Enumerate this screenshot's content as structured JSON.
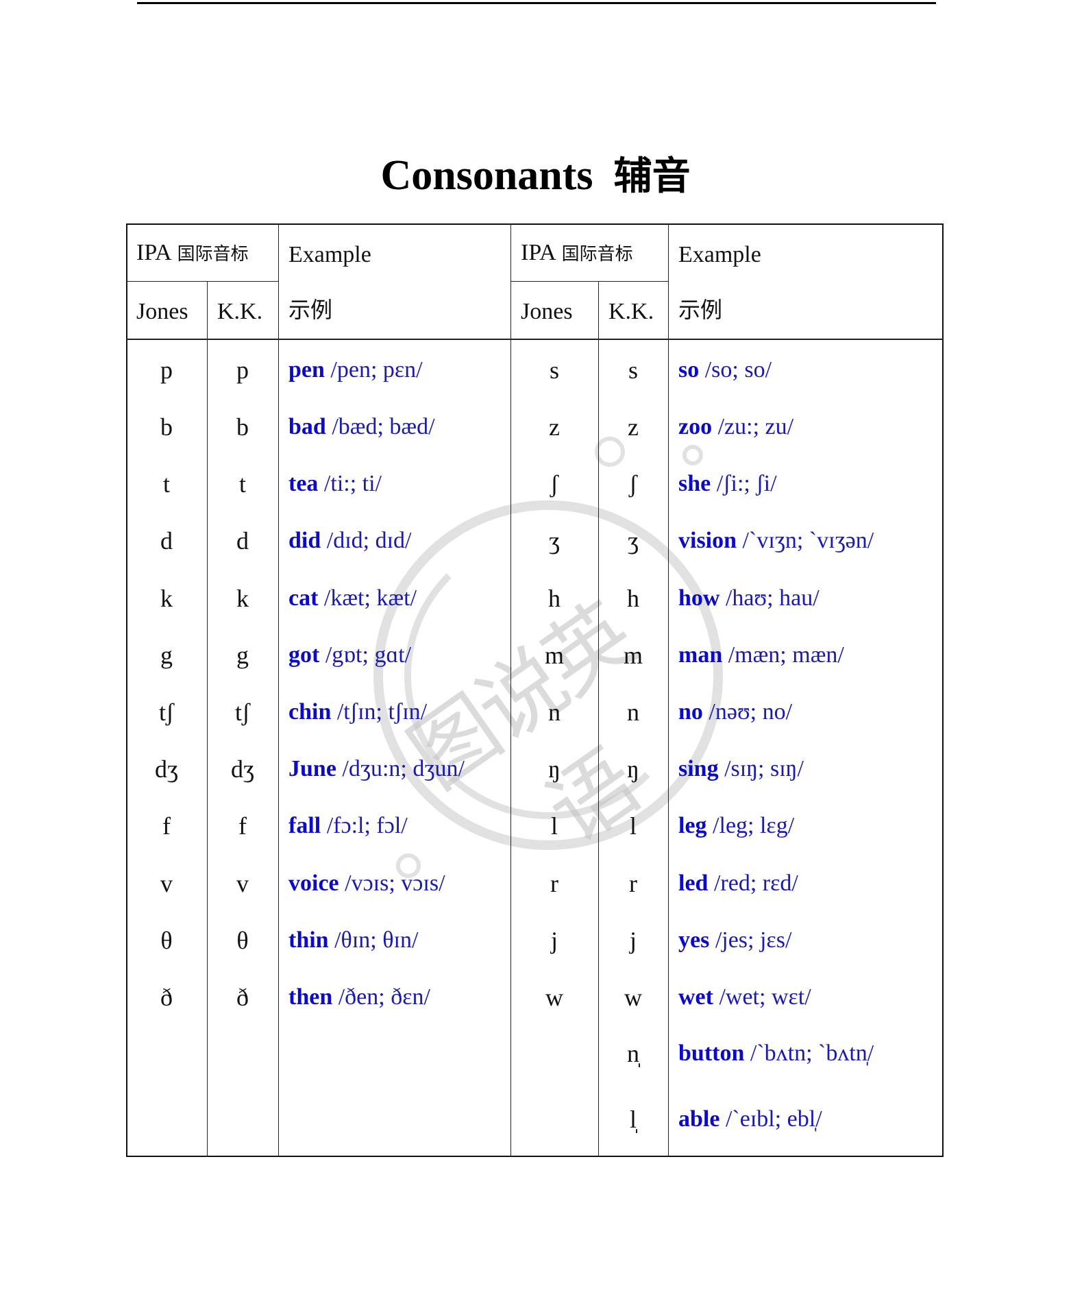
{
  "title": {
    "en": "Consonants",
    "zh": "辅音"
  },
  "watermark": {
    "text": "图说英语"
  },
  "header": {
    "ipa_label": "IPA",
    "ipa_zh": "国际音标",
    "jones": "Jones",
    "kk": "K.K.",
    "example_en": "Example",
    "example_zh": "示例"
  },
  "colors": {
    "example_word": "#0a0ac8",
    "transcription": "#1a1ab0",
    "text": "#111111",
    "border": "#111111"
  },
  "left_rows": [
    {
      "jones": "p",
      "kk": "p",
      "word": "pen",
      "transcription": "/pen; pɛn/"
    },
    {
      "jones": "b",
      "kk": "b",
      "word": "bad",
      "transcription": "/bæd; bæd/"
    },
    {
      "jones": "t",
      "kk": "t",
      "word": "tea",
      "transcription": "/ti:; ti/"
    },
    {
      "jones": "d",
      "kk": "d",
      "word": "did",
      "transcription": "/dɪd; dɪd/"
    },
    {
      "jones": "k",
      "kk": "k",
      "word": "cat",
      "transcription": "/kæt; kæt/"
    },
    {
      "jones": "g",
      "kk": "g",
      "word": "got",
      "transcription": "/gɒt; gɑt/"
    },
    {
      "jones": "tʃ",
      "kk": "tʃ",
      "word": "chin",
      "transcription": "/tʃɪn; tʃɪn/"
    },
    {
      "jones": "dʒ",
      "kk": "dʒ",
      "word": "June",
      "transcription": "/dʒu:n; dʒun/"
    },
    {
      "jones": "f",
      "kk": "f",
      "word": "fall",
      "transcription": "/fɔ:l; fɔl/"
    },
    {
      "jones": "v",
      "kk": "v",
      "word": "voice",
      "transcription": "/vɔɪs; vɔɪs/"
    },
    {
      "jones": "θ",
      "kk": "θ",
      "word": "thin",
      "transcription": "/θɪn; θɪn/"
    },
    {
      "jones": "ð",
      "kk": "ð",
      "word": "then",
      "transcription": "/ðen; ðɛn/"
    }
  ],
  "right_rows": [
    {
      "jones": "s",
      "kk": "s",
      "word": "so",
      "transcription": "/so; so/"
    },
    {
      "jones": "z",
      "kk": "z",
      "word": "zoo",
      "transcription": "/zu:; zu/"
    },
    {
      "jones": "ʃ",
      "kk": "ʃ",
      "word": "she",
      "transcription": "/ʃi:; ʃi/"
    },
    {
      "jones": "ʒ",
      "kk": "ʒ",
      "word": "vision",
      "transcription": "/`vɪʒn; `vɪʒən/"
    },
    {
      "jones": "h",
      "kk": "h",
      "word": "how",
      "transcription": "/haʊ; hau/"
    },
    {
      "jones": "m",
      "kk": "m",
      "word": "man",
      "transcription": "/mæn; mæn/"
    },
    {
      "jones": "n",
      "kk": "n",
      "word": "no",
      "transcription": "/nəʊ; no/"
    },
    {
      "jones": "ŋ",
      "kk": "ŋ",
      "word": "sing",
      "transcription": "/sɪŋ; sɪŋ/"
    },
    {
      "jones": "l",
      "kk": "l",
      "word": "leg",
      "transcription": "/leg; lɛg/"
    },
    {
      "jones": "r",
      "kk": "r",
      "word": "led",
      "transcription": "/red; rɛd/"
    },
    {
      "jones": "j",
      "kk": "j",
      "word": "yes",
      "transcription": "/jes; jɛs/"
    },
    {
      "jones": "w",
      "kk": "w",
      "word": "wet",
      "transcription": "/wet; wɛt/"
    },
    {
      "jones": "",
      "kk": "n̩",
      "word": "button",
      "transcription": "/`bʌtn; `bʌtn̩/"
    },
    {
      "jones": "",
      "kk": "l̩",
      "word": "able",
      "transcription": "/`eɪbl; ebl̩/"
    }
  ]
}
